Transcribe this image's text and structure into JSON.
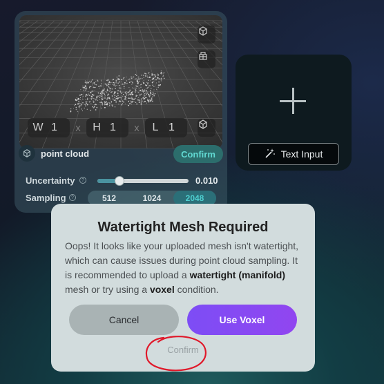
{
  "dims": [
    {
      "label": "W",
      "value": "1"
    },
    {
      "label": "H",
      "value": "1"
    },
    {
      "label": "L",
      "value": "1"
    }
  ],
  "dim_separator": "x",
  "asset": {
    "label": "point cloud",
    "confirm_label": "Confirm"
  },
  "params": {
    "uncertainty": {
      "label": "Uncertainty",
      "value": "0.010",
      "fraction": 0.24
    },
    "sampling": {
      "label": "Sampling",
      "options": [
        "512",
        "1024",
        "2048"
      ],
      "selected": "2048"
    }
  },
  "right_card": {
    "text_input_label": "Text Input"
  },
  "modal": {
    "title": "Watertight Mesh Required",
    "body_1": "Oops! It looks like your uploaded mesh isn't watertight, which can cause issues during point cloud sampling. It is recommended to upload a ",
    "body_bold_1": "watertight (manifold)",
    "body_2": " mesh or try using a ",
    "body_bold_2": "voxel",
    "body_3": " condition.",
    "cancel_label": "Cancel",
    "use_voxel_label": "Use Voxel",
    "confirm_label": "Confirm"
  },
  "colors": {
    "accent": "#2c6d6c",
    "accent_text": "#61d9d2",
    "voxel_button": "#8a48f2",
    "annotation": "#e0192a"
  }
}
